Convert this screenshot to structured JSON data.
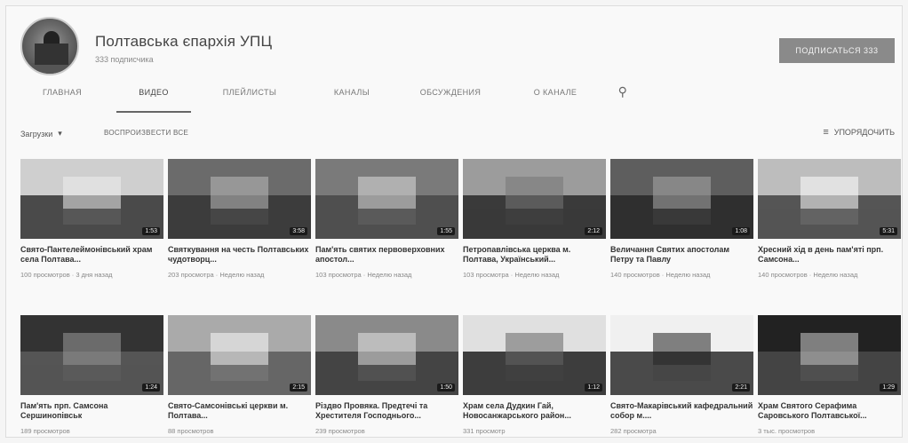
{
  "channel": {
    "name": "Полтавська єпархія УПЦ",
    "subscribers": "333 подписчика"
  },
  "subscribe_label": "ПОДПИСАТЬСЯ 333",
  "tabs": [
    {
      "label": "ГЛАВНАЯ"
    },
    {
      "label": "ВИДЕО"
    },
    {
      "label": "ПЛЕЙЛИСТЫ"
    },
    {
      "label": "КАНАЛЫ"
    },
    {
      "label": "ОБСУЖДЕНИЯ"
    },
    {
      "label": "О КАНАЛЕ"
    }
  ],
  "toolbar": {
    "uploads_label": "Загрузки",
    "play_all": "ВОСПРОИЗВЕСТИ ВСЕ",
    "sort_label": "УПОРЯДОЧИТЬ"
  },
  "videos": [
    {
      "title": "Свято-Пантелеймонівський храм села Полтава...",
      "views": "100 просмотров",
      "age": "3 дня назад",
      "duration": "1:53"
    },
    {
      "title": "Святкування на честь Полтавських чудотворц...",
      "views": "203 просмотра",
      "age": "Неделю назад",
      "duration": "3:58"
    },
    {
      "title": "Пам'ять святих первоверховних апостол...",
      "views": "103 просмотра",
      "age": "Неделю назад",
      "duration": "1:55"
    },
    {
      "title": "Петропавлівська церква м. Полтава, Український...",
      "views": "103 просмотра",
      "age": "Неделю назад",
      "duration": "2:12"
    },
    {
      "title": "Величання Святих апостолам Петру та Павлу",
      "views": "140 просмотров",
      "age": "Неделю назад",
      "duration": "1:08"
    },
    {
      "title": "Хресний хід в день пам'яті прп. Самсона...",
      "views": "140 просмотров",
      "age": "Неделю назад",
      "duration": "5:31"
    },
    {
      "title": "Пам'ять прп. Самсона Сершинопівськ",
      "views": "189 просмотров",
      "age": "",
      "duration": "1:24"
    },
    {
      "title": "Свято-Самсонівські церкви м. Полтава...",
      "views": "88 просмотров",
      "age": "",
      "duration": "2:15"
    },
    {
      "title": "Різдво Провяка. Предтечі та Хрестителя Господнього...",
      "views": "239 просмотров",
      "age": "",
      "duration": "1:50"
    },
    {
      "title": "Храм села Дудкин Гай, Новосанжарського район...",
      "views": "331 просмотр",
      "age": "",
      "duration": "1:12"
    },
    {
      "title": "Свято-Макарівський кафедральний собор м....",
      "views": "282 просмотра",
      "age": "",
      "duration": "2:21"
    },
    {
      "title": "Храм Святого Серафима Саровського Полтавської...",
      "views": "3 тыс. просмотров",
      "age": "",
      "duration": "1:29"
    }
  ]
}
